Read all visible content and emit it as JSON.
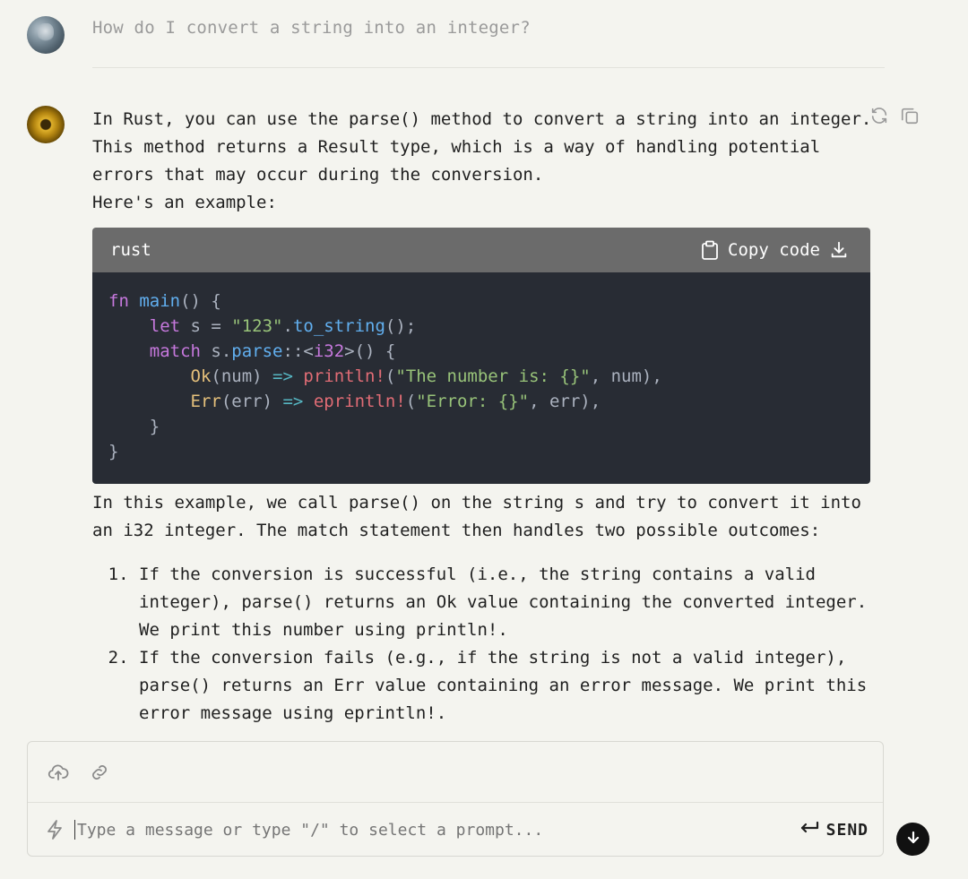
{
  "user_message": "How do I convert a string into an integer?",
  "assistant": {
    "intro": "In Rust, you can use the parse() method to convert a string into an integer.\nThis method returns a Result type, which is a way of handling potential\nerrors that may occur during the conversion.\nHere's an example:",
    "code": {
      "language": "rust",
      "copy_label": "Copy code"
    },
    "explanation": "In this example, we call parse() on the string s and try to convert it into\nan i32 integer. The match statement then handles two possible outcomes:",
    "list": [
      "If the conversion is successful (i.e., the string contains a valid\ninteger), parse() returns an Ok value containing the converted integer.\nWe print this number using println!.",
      "If the conversion fails (e.g., if the string is not a valid integer),\nparse() returns an Err value containing an error message. We print this\nerror message using eprintln!."
    ]
  },
  "composer": {
    "placeholder": "Type a message or type \"/\" to select a prompt...",
    "send_label": "SEND"
  },
  "icons": [
    "user-avatar",
    "bot-avatar",
    "regenerate-icon",
    "copy-message-icon",
    "clipboard-icon",
    "download-icon",
    "upload-cloud-icon",
    "link-icon",
    "bolt-icon",
    "return-icon",
    "arrow-down-icon"
  ]
}
